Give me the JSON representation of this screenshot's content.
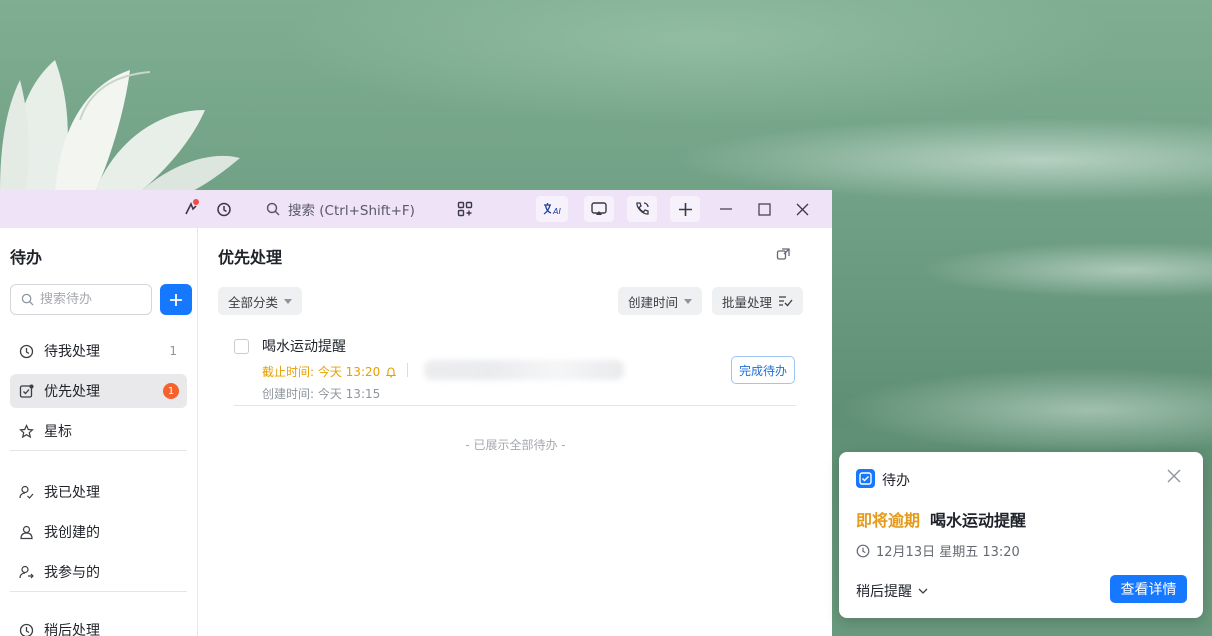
{
  "titlebar": {
    "search_placeholder": "搜索 (Ctrl+Shift+F)"
  },
  "sidebar": {
    "title": "待办",
    "search_placeholder": "搜索待办",
    "items": [
      {
        "label": "待我处理",
        "count": "1"
      },
      {
        "label": "优先处理",
        "badge": "1"
      },
      {
        "label": "星标"
      },
      {
        "label": "我已处理"
      },
      {
        "label": "我创建的"
      },
      {
        "label": "我参与的"
      },
      {
        "label": "稍后处理"
      }
    ]
  },
  "main": {
    "title": "优先处理",
    "filters": {
      "category": "全部分类",
      "sort": "创建时间",
      "batch": "批量处理"
    },
    "task": {
      "title": "喝水运动提醒",
      "deadline": "截止时间: 今天 13:20",
      "created": "创建时间: 今天 13:15",
      "complete_label": "完成待办"
    },
    "footer": "- 已展示全部待办 -"
  },
  "notification": {
    "app_name": "待办",
    "tag": "即将逾期",
    "title": "喝水运动提醒",
    "time": "12月13日 星期五 13:20",
    "snooze_label": "稍后提醒",
    "detail_label": "查看详情"
  },
  "colors": {
    "accent": "#1677ff",
    "deadline": "#e5a000",
    "badge": "#f5622d",
    "titlebar": "#efe3f7"
  }
}
